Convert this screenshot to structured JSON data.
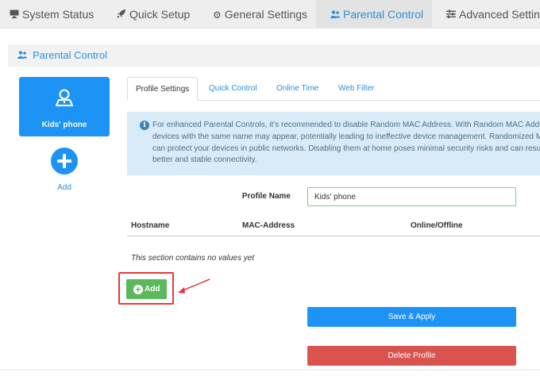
{
  "nav": {
    "items": [
      {
        "label": "System Status",
        "icon": "monitor-icon"
      },
      {
        "label": "Quick Setup",
        "icon": "rocket-icon"
      },
      {
        "label": "General Settings",
        "icon": "gear-icon"
      },
      {
        "label": "Parental Control",
        "icon": "users-icon",
        "active": true
      },
      {
        "label": "Advanced Settings",
        "icon": "sliders-icon"
      }
    ]
  },
  "section": {
    "title": "Parental Control"
  },
  "profiles": [
    {
      "name": "Kids' phone",
      "icon": "person-icon",
      "selected": true
    }
  ],
  "add_profile_label": "Add",
  "tabs": [
    {
      "label": "Profile Settings",
      "active": true
    },
    {
      "label": "Quick Control"
    },
    {
      "label": "Online Time"
    },
    {
      "label": "Web Filter"
    }
  ],
  "info": {
    "text": "For enhanced Parental Controls, it's recommended to disable Random MAC Address. With Random MAC Address, devices with the same name may appear, potentially leading to ineffective device management. Randomized MAC can protect your devices in public networks. Disabling them at home poses minimal security risks and can result in better and stable connectivity."
  },
  "form": {
    "profile_name_label": "Profile Name",
    "profile_name_value": "Kids' phone"
  },
  "table": {
    "columns": [
      "Hostname",
      "MAC-Address",
      "Online/Offline"
    ],
    "empty_message": "This section contains no values yet",
    "add_button": "Add"
  },
  "actions": {
    "save": "Save & Apply",
    "delete": "Delete Profile"
  },
  "colors": {
    "accent": "#1e93f6",
    "link": "#2f8fd8",
    "add_green": "#5cb85c",
    "delete_red": "#d9534f",
    "highlight": "#e43b3b",
    "info_bg": "#d9ebf6"
  }
}
